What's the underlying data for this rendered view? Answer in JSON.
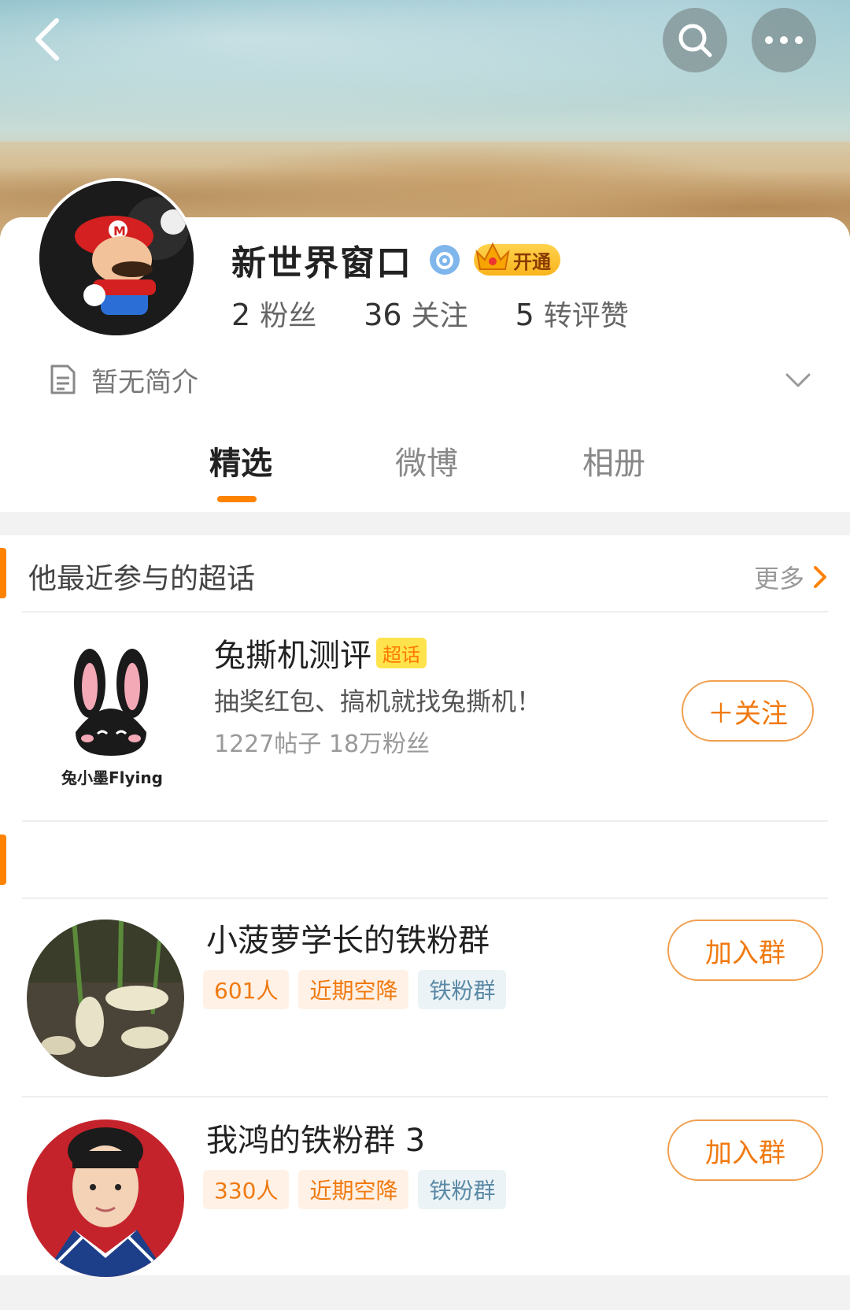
{
  "header": {
    "back_icon": "chevron-left-icon",
    "search_icon": "search-icon",
    "more_icon": "more-dots-icon"
  },
  "profile": {
    "username": "新世界窗口",
    "vip_label": "开通",
    "stats": [
      {
        "num": "2",
        "label": "粉丝"
      },
      {
        "num": "36",
        "label": "关注"
      },
      {
        "num": "5",
        "label": "转评赞"
      }
    ],
    "bio": "暂无简介"
  },
  "tabs": [
    "精选",
    "微博",
    "相册"
  ],
  "super_topics": {
    "title": "他最近参与的超话",
    "more": "更多",
    "item": {
      "name": "兔撕机测评",
      "tag": "超话",
      "desc": "抽奖红包、搞机就找兔撕机！",
      "meta": "1227帖子 18万粉丝",
      "logo_caption": "兔小墨Flying",
      "follow_label": "＋关注"
    }
  },
  "groups": {
    "items": [
      {
        "name": "小菠萝学长的铁粉群",
        "chips": [
          "601人",
          "近期空降",
          "铁粉群"
        ],
        "action": "加入群"
      },
      {
        "name": "我鸿的铁粉群 3",
        "chips": [
          "330人",
          "近期空降",
          "铁粉群"
        ],
        "action": "加入群"
      }
    ]
  },
  "colors": {
    "accent": "#ff8200",
    "tag_yellow": "#ffe34d"
  }
}
